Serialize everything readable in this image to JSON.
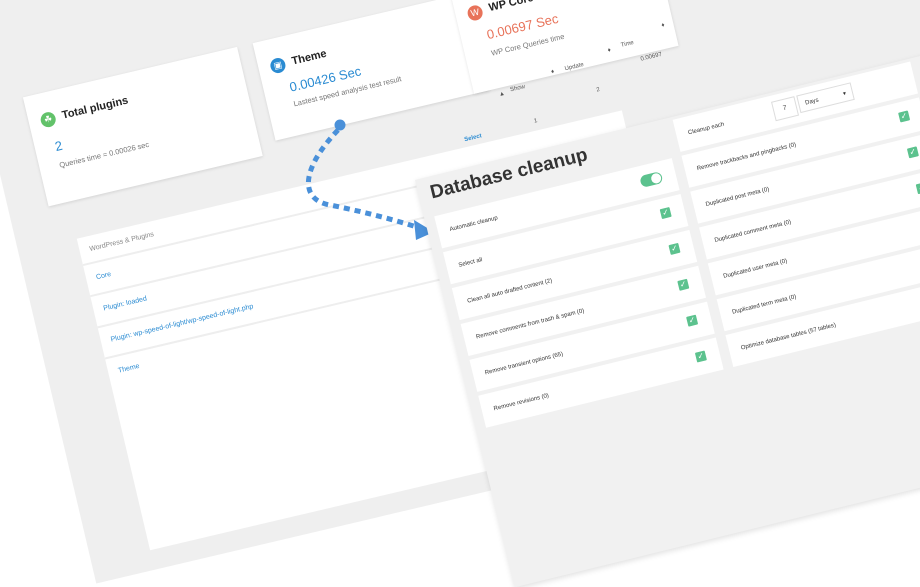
{
  "cards": {
    "total_plugins": {
      "title": "Total plugins",
      "value": "2",
      "subtitle": "Queries time = 0.00026 sec"
    },
    "theme": {
      "title": "Theme",
      "value": "0.00426 Sec",
      "subtitle": "Lastest speed analysis test result"
    },
    "wp_core": {
      "title": "WP Core",
      "value": "0.00697 Sec",
      "subtitle": "WP Core Queries time"
    }
  },
  "table": {
    "col_select": "Select",
    "col_show": "Show",
    "col_update": "Update",
    "col_time": "Time",
    "val_time": "0.00697",
    "val_update": "2",
    "val_show": "1",
    "val_select": "21"
  },
  "wp_list": {
    "header": "WordPress & Plugins",
    "items": [
      "Core",
      "Plugin: loaded",
      "Plugin: wp-speed-of-light/wp-speed-of-light.php",
      "Theme"
    ]
  },
  "db": {
    "title": "Database cleanup",
    "left": [
      {
        "label": "Automatic cleanup",
        "control": "toggle"
      },
      {
        "label": "Select all",
        "control": "check"
      },
      {
        "label": "Clean all auto drafted content  (2)",
        "control": "check"
      },
      {
        "label": "Remove comments from trash & spam  (0)",
        "control": "check"
      },
      {
        "label": "Remove transient options  (65)",
        "control": "check"
      },
      {
        "label": "Remove revisions  (0)",
        "control": "check"
      }
    ],
    "cleanup_each": {
      "label": "Cleanup each",
      "number": "7",
      "unit": "Days"
    },
    "right": [
      {
        "label": "Remove trackbacks and pingbacks  (0)"
      },
      {
        "label": "Duplicated post meta  (0)"
      },
      {
        "label": "Duplicated comment meta  (0)"
      },
      {
        "label": "Duplicated user meta  (0)"
      },
      {
        "label": "Duplicated term meta  (0)"
      },
      {
        "label": "Optimize database tables  (57 tables)"
      }
    ]
  },
  "colors": {
    "accent_blue": "#2a8bd2",
    "green": "#5cc28e",
    "coral": "#e8735a",
    "arrow_blue": "#4a90d9"
  }
}
